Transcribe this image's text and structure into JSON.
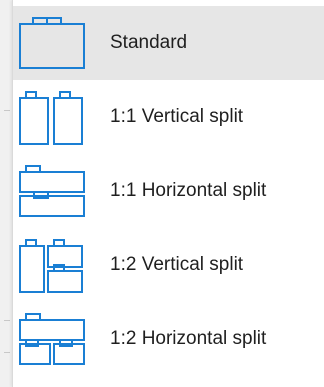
{
  "accent_color": "#1a7fd4",
  "layout_menu": {
    "items": [
      {
        "label": "Standard",
        "icon": "standard-layout-icon",
        "selected": true
      },
      {
        "label": "1:1 Vertical split",
        "icon": "vertical-split-1-1-icon",
        "selected": false
      },
      {
        "label": "1:1 Horizontal split",
        "icon": "horizontal-split-1-1-icon",
        "selected": false
      },
      {
        "label": "1:2 Vertical split",
        "icon": "vertical-split-1-2-icon",
        "selected": false
      },
      {
        "label": "1:2 Horizontal split",
        "icon": "horizontal-split-1-2-icon",
        "selected": false
      }
    ]
  }
}
